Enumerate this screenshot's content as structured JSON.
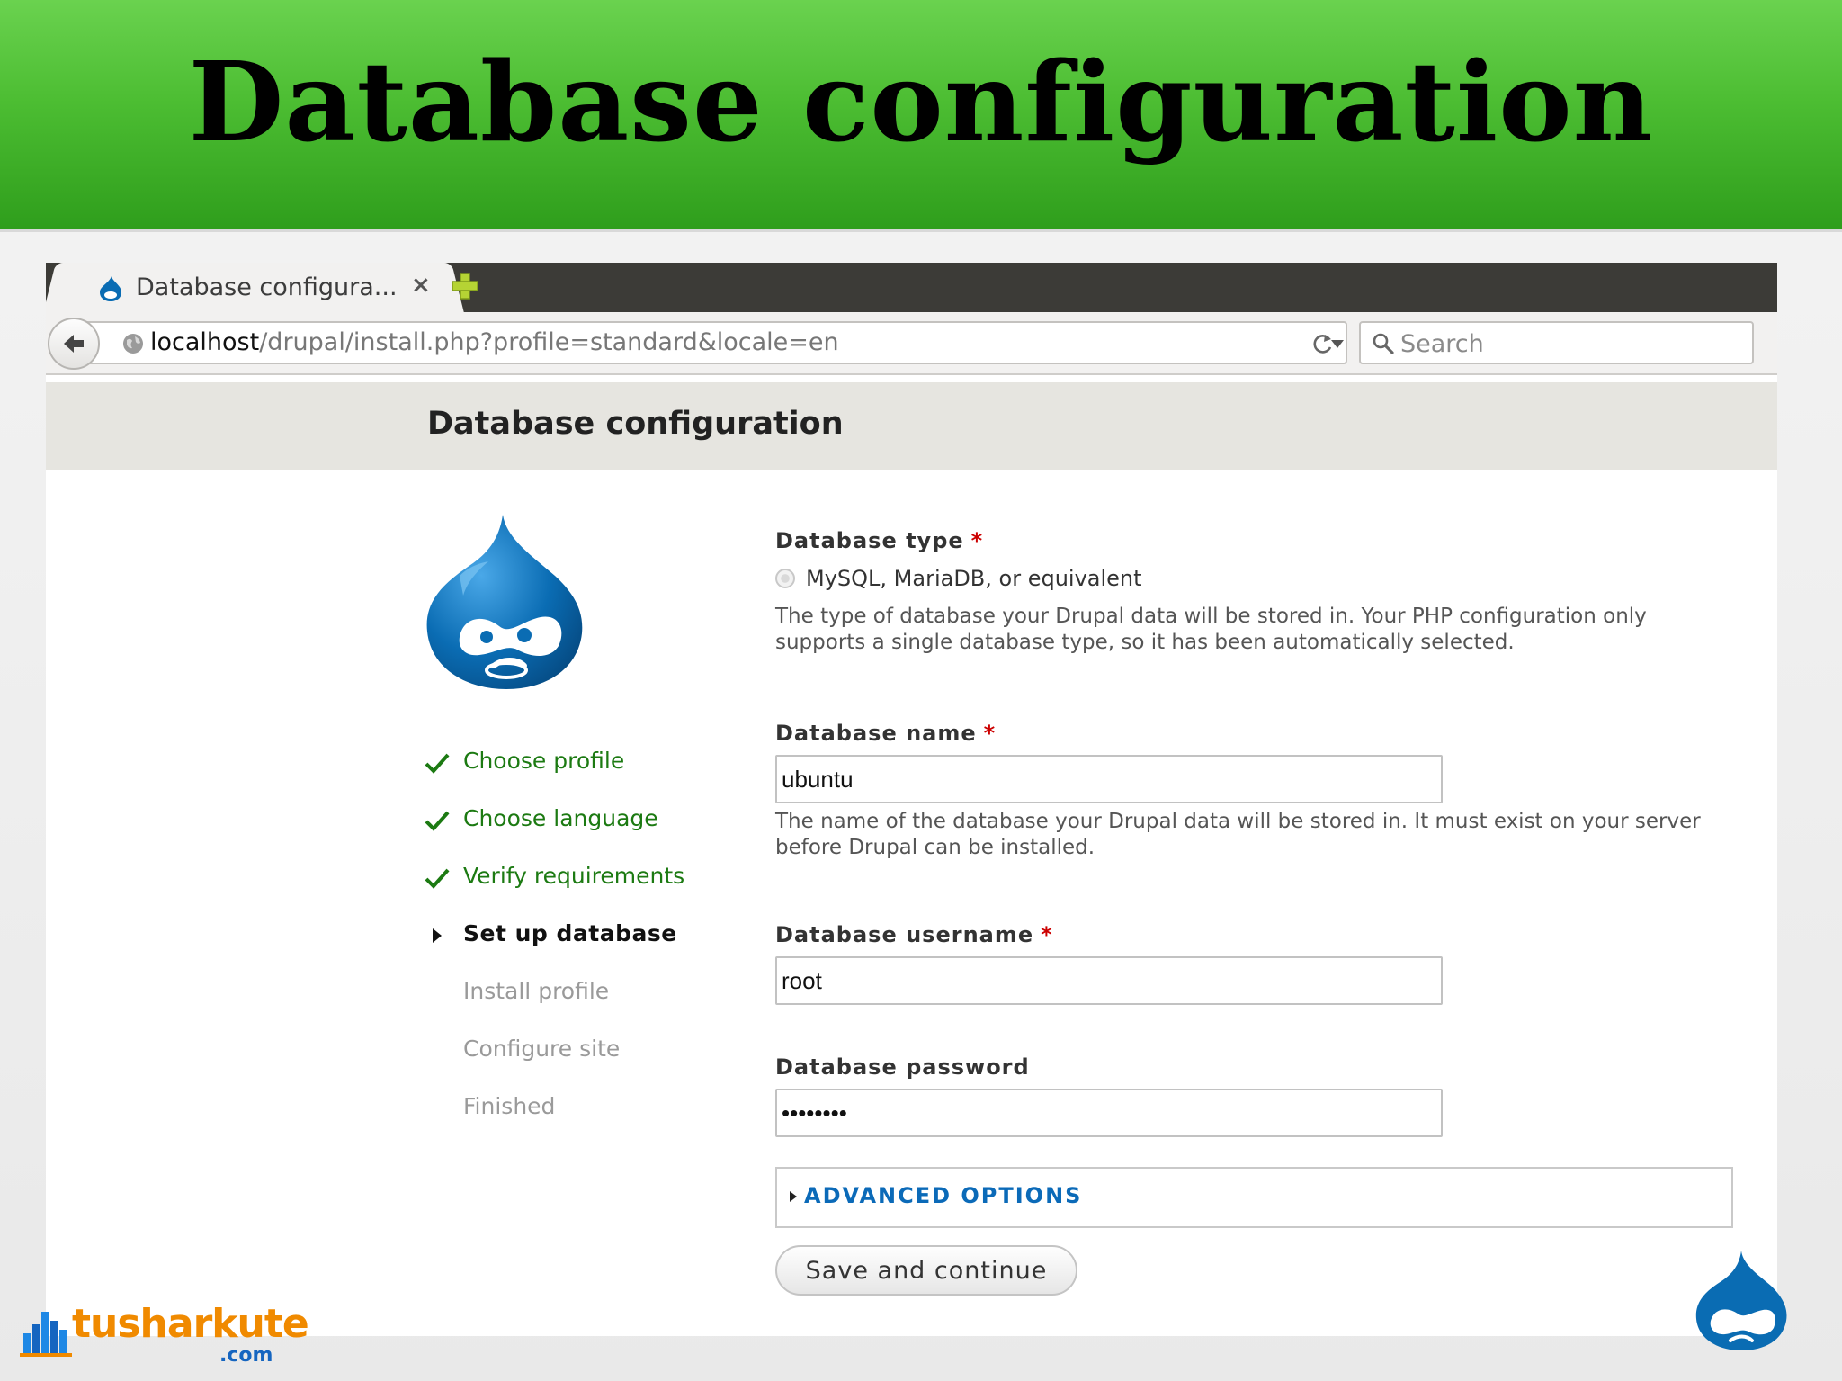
{
  "slide": {
    "title": "Database configuration"
  },
  "browser": {
    "tab_title": "Database configura...",
    "tab_close": "×",
    "url_host": "localhost",
    "url_path": "/drupal/install.php?profile=standard&locale=en",
    "search_placeholder": "Search"
  },
  "page": {
    "title": "Database configuration"
  },
  "steps": [
    {
      "label": "Choose profile",
      "state": "done"
    },
    {
      "label": "Choose language",
      "state": "done"
    },
    {
      "label": "Verify requirements",
      "state": "done"
    },
    {
      "label": "Set up database",
      "state": "active"
    },
    {
      "label": "Install profile",
      "state": "pending"
    },
    {
      "label": "Configure site",
      "state": "pending"
    },
    {
      "label": "Finished",
      "state": "pending"
    }
  ],
  "form": {
    "db_type": {
      "label": "Database type",
      "required_mark": "*",
      "option": "MySQL, MariaDB, or equivalent",
      "help": "The type of database your Drupal data will be stored in. Your PHP configuration only supports a single database type, so it has been automatically selected."
    },
    "db_name": {
      "label": "Database name",
      "required_mark": "*",
      "value": "ubuntu",
      "help": "The name of the database your Drupal data will be stored in. It must exist on your server before Drupal can be installed."
    },
    "db_username": {
      "label": "Database username",
      "required_mark": "*",
      "value": "root"
    },
    "db_password": {
      "label": "Database password",
      "value": "••••••••"
    },
    "advanced_label": "ADVANCED OPTIONS",
    "save_label": "Save and continue"
  },
  "branding": {
    "name": "tusharkute",
    "suffix": ".com"
  },
  "colors": {
    "header_green": "#4cbd32",
    "done_green": "#1c7a12",
    "link_blue": "#0b6ab8",
    "required_red": "#cc0000",
    "drupal_blue": "#0a6cb3",
    "brand_orange": "#f08a00"
  }
}
